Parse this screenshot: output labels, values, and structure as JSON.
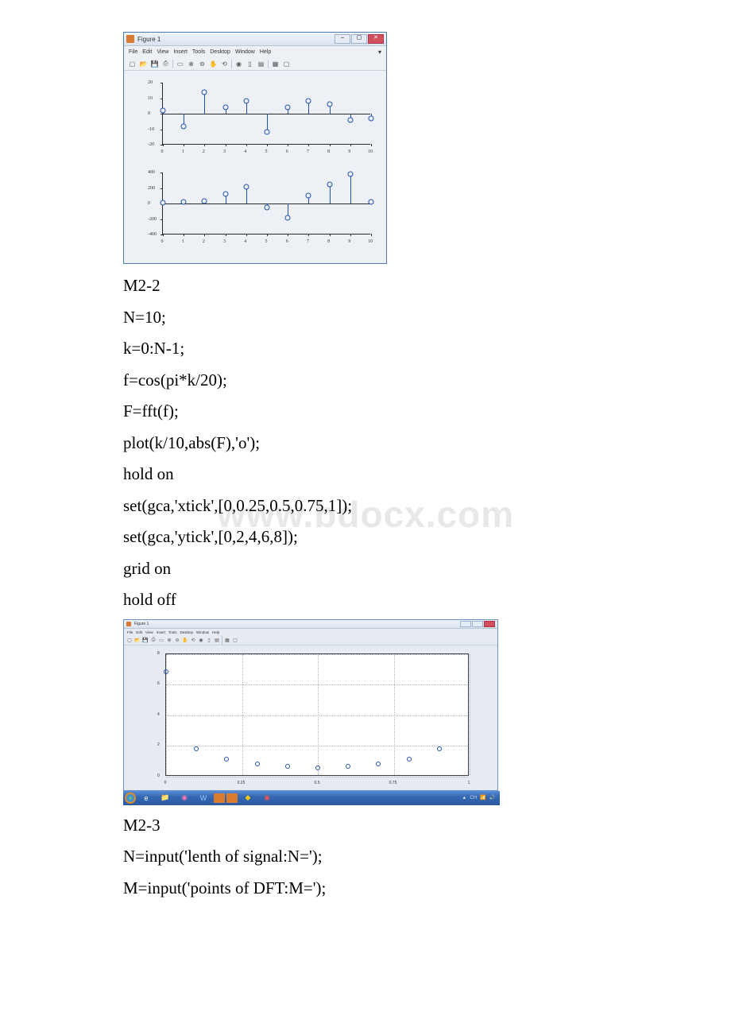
{
  "watermark": "www.bdocx.com",
  "figure1": {
    "title": "Figure 1",
    "menus": [
      "File",
      "Edit",
      "View",
      "Insert",
      "Tools",
      "Desktop",
      "Window",
      "Help"
    ],
    "toolbar_icons": [
      "new",
      "open",
      "save",
      "print",
      "sep",
      "pointer",
      "zoom-in",
      "zoom-out",
      "pan",
      "rotate",
      "sep",
      "datacursor",
      "colorbar",
      "legend",
      "sep",
      "linkplot",
      "insert"
    ]
  },
  "figure2": {
    "title": "Figure 1",
    "menus": [
      "File",
      "Edit",
      "View",
      "Insert",
      "Tools",
      "Desktop",
      "Window",
      "Help"
    ],
    "toolbar_icons": [
      "new",
      "open",
      "save",
      "print",
      "pointer",
      "zoom-in",
      "zoom-out",
      "pan",
      "rotate",
      "datacursor",
      "colorbar",
      "legend",
      "linkplot",
      "insert"
    ],
    "taskbar_icons": [
      "start",
      "ie",
      "folder",
      "player",
      "word",
      "matlab",
      "fig",
      "tw",
      "vol"
    ]
  },
  "code": {
    "m22_heading": "M2-2",
    "line_N": "N=10;",
    "line_k": "k=0:N-1;",
    "line_f": "f=cos(pi*k/20);",
    "line_F": "F=fft(f);",
    "line_plot": "plot(k/10,abs(F),'o');",
    "line_hold1": "hold on",
    "line_xtick": "set(gca,'xtick',[0,0.25,0.5,0.75,1]);",
    "line_ytick": "set(gca,'ytick',[0,2,4,6,8]);",
    "line_grid": "grid on",
    "line_hold2": "hold off",
    "m23_heading": "M2-3",
    "line_Nin": "N=input('lenth of signal:N=');",
    "line_Min": "M=input('points of DFT:M=');"
  },
  "chart_data": [
    {
      "figure": 1,
      "subplot": 1,
      "type": "stem",
      "x": [
        0,
        1,
        2,
        3,
        4,
        5,
        6,
        7,
        8,
        9,
        10
      ],
      "values": [
        2,
        -8,
        14,
        4,
        8,
        -12,
        4,
        8,
        6,
        -4,
        -3
      ],
      "ylim": [
        -20,
        20
      ],
      "xlim": [
        0,
        10
      ],
      "yticks": [
        -20,
        -10,
        0,
        10,
        20
      ],
      "xticks": [
        0,
        1,
        2,
        3,
        4,
        5,
        6,
        7,
        8,
        9,
        10
      ]
    },
    {
      "figure": 1,
      "subplot": 2,
      "type": "stem",
      "x": [
        0,
        1,
        2,
        3,
        4,
        5,
        6,
        7,
        8,
        9,
        10
      ],
      "values": [
        10,
        20,
        30,
        120,
        220,
        -50,
        -180,
        100,
        250,
        380,
        20
      ],
      "ylim": [
        -400,
        400
      ],
      "xlim": [
        0,
        10
      ],
      "yticks": [
        -400,
        -200,
        0,
        200,
        400
      ],
      "xticks": [
        0,
        1,
        2,
        3,
        4,
        5,
        6,
        7,
        8,
        9,
        10
      ]
    },
    {
      "figure": 2,
      "type": "scatter",
      "x": [
        0,
        0.1,
        0.2,
        0.3,
        0.4,
        0.5,
        0.6,
        0.7,
        0.8,
        0.9
      ],
      "values": [
        6.85,
        1.8,
        1.1,
        0.8,
        0.65,
        0.55,
        0.65,
        0.8,
        1.1,
        1.8
      ],
      "xlim": [
        0,
        1
      ],
      "ylim": [
        0,
        8
      ],
      "xticks": [
        0,
        0.25,
        0.5,
        0.75,
        1
      ],
      "yticks": [
        0,
        2,
        4,
        6,
        8
      ],
      "grid": true
    }
  ]
}
